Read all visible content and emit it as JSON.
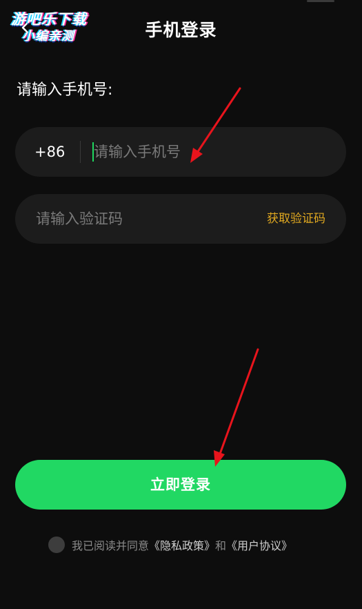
{
  "watermark": {
    "line1": "游吧乐下载",
    "line2": "小编亲测"
  },
  "header": {
    "title": "手机登录"
  },
  "phone_section": {
    "prompt": "请输入手机号:",
    "country_code": "+86",
    "placeholder": "请输入手机号"
  },
  "code_section": {
    "placeholder": "请输入验证码",
    "get_code_label": "获取验证码"
  },
  "login": {
    "button_label": "立即登录"
  },
  "agreement": {
    "prefix": "我已阅读并同意",
    "privacy_link": "《隐私政策》",
    "joiner": "和",
    "user_link": "《用户协议》",
    "checked": false
  },
  "colors": {
    "background": "#0d0d0d",
    "field_bg": "#1c1c1c",
    "accent_green": "#21d863",
    "accent_gold": "#e0a820",
    "annotation_red": "#e8141c"
  }
}
